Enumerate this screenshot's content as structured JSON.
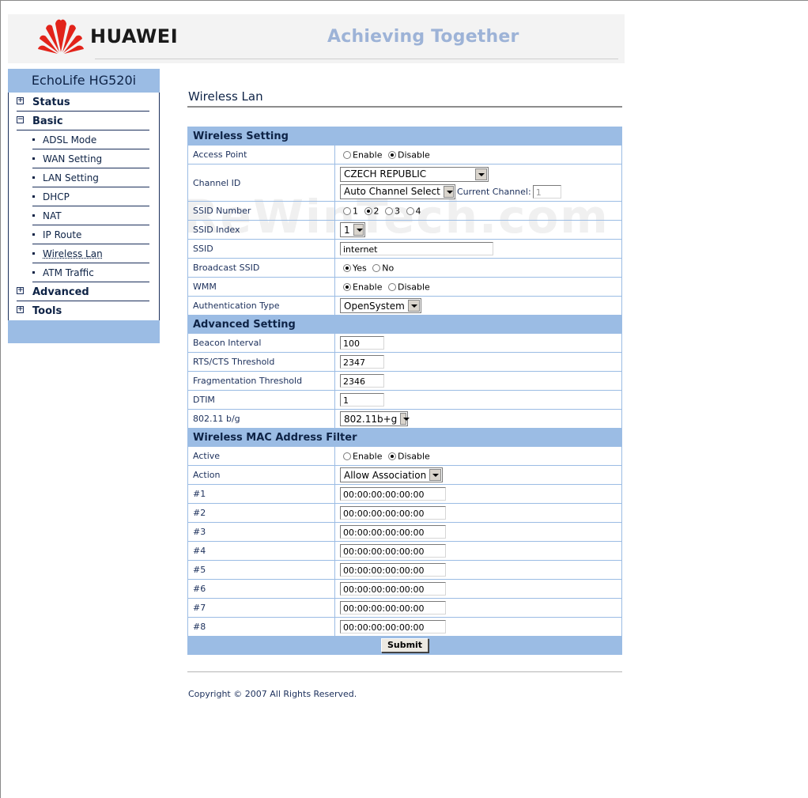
{
  "header": {
    "brand": "HUAWEI",
    "tagline": "Achieving Together",
    "brand_color": "#e2231a"
  },
  "sidebar": {
    "model": "EchoLife HG520i",
    "sections": [
      {
        "label": "Status",
        "expanded": false
      },
      {
        "label": "Basic",
        "expanded": true
      },
      {
        "label": "Advanced",
        "expanded": false
      },
      {
        "label": "Tools",
        "expanded": false
      }
    ],
    "basic_items": [
      "ADSL Mode",
      "WAN Setting",
      "LAN Setting",
      "DHCP",
      "NAT",
      "IP Route",
      "Wireless Lan",
      "ATM Traffic"
    ],
    "active_item": "Wireless Lan"
  },
  "page": {
    "title": "Wireless Lan"
  },
  "wireless_setting": {
    "heading": "Wireless Setting",
    "access_point": {
      "label": "Access Point",
      "options": [
        "Enable",
        "Disable"
      ],
      "selected": "Disable"
    },
    "channel_id": {
      "label": "Channel ID",
      "country": "CZECH REPUBLIC",
      "channel": "Auto Channel Select",
      "current_channel_label": "Current Channel:",
      "current_channel": "1"
    },
    "ssid_number": {
      "label": "SSID Number",
      "options": [
        "1",
        "2",
        "3",
        "4"
      ],
      "selected": "2"
    },
    "ssid_index": {
      "label": "SSID Index",
      "value": "1"
    },
    "ssid": {
      "label": "SSID",
      "value": "internet"
    },
    "broadcast_ssid": {
      "label": "Broadcast SSID",
      "options": [
        "Yes",
        "No"
      ],
      "selected": "Yes"
    },
    "wmm": {
      "label": "WMM",
      "options": [
        "Enable",
        "Disable"
      ],
      "selected": "Enable"
    },
    "auth_type": {
      "label": "Authentication Type",
      "value": "OpenSystem"
    }
  },
  "advanced_setting": {
    "heading": "Advanced Setting",
    "beacon": {
      "label": "Beacon Interval",
      "value": "100"
    },
    "rts": {
      "label": "RTS/CTS Threshold",
      "value": "2347"
    },
    "frag": {
      "label": "Fragmentation Threshold",
      "value": "2346"
    },
    "dtim": {
      "label": "DTIM",
      "value": "1"
    },
    "mode": {
      "label": "802.11 b/g",
      "value": "802.11b+g"
    }
  },
  "mac_filter": {
    "heading": "Wireless MAC Address Filter",
    "active": {
      "label": "Active",
      "options": [
        "Enable",
        "Disable"
      ],
      "selected": "Disable"
    },
    "action": {
      "label": "Action",
      "value": "Allow Association"
    },
    "entries": [
      {
        "label": "#1",
        "value": "00:00:00:00:00:00"
      },
      {
        "label": "#2",
        "value": "00:00:00:00:00:00"
      },
      {
        "label": "#3",
        "value": "00:00:00:00:00:00"
      },
      {
        "label": "#4",
        "value": "00:00:00:00:00:00"
      },
      {
        "label": "#5",
        "value": "00:00:00:00:00:00"
      },
      {
        "label": "#6",
        "value": "00:00:00:00:00:00"
      },
      {
        "label": "#7",
        "value": "00:00:00:00:00:00"
      },
      {
        "label": "#8",
        "value": "00:00:00:00:00:00"
      }
    ]
  },
  "submit_label": "Submit",
  "copyright": "Copyright © 2007 All Rights Reserved.",
  "watermark": "ReWinTech.com"
}
